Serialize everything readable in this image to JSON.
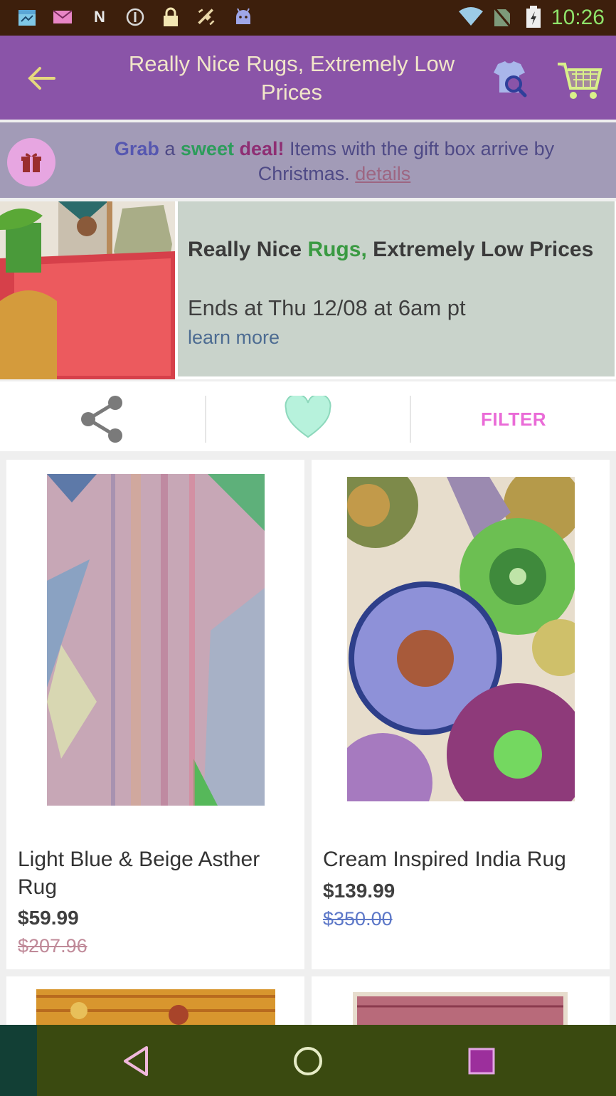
{
  "statusbar": {
    "time": "10:26",
    "icons": [
      "calendar-icon",
      "mail-icon",
      "notification-n-icon",
      "info-circle-icon",
      "lock-icon",
      "satellite-icon",
      "android-icon",
      "wifi-icon",
      "no-sim-icon",
      "battery-charging-icon"
    ]
  },
  "appbar": {
    "title": "Really Nice Rugs, Extremely Low Prices",
    "icons": [
      "back-arrow-icon",
      "search-shirt-icon",
      "cart-icon"
    ]
  },
  "promo": {
    "t1": "Grab",
    "t2": " a ",
    "t3": "sweet",
    "t4": " ",
    "t5": "deal!",
    "t6": " Items with the gift box arrive by Christmas.",
    "details": "details",
    "icon": "gift-icon"
  },
  "hero": {
    "title_a": "Really Nice ",
    "title_b": "Rugs,",
    "title_c": " Extremely Low Prices",
    "ends": "Ends at Thu 12/08 at 6am pt",
    "learn_more": "learn more"
  },
  "actions": {
    "filter": "FILTER",
    "icons": [
      "share-icon",
      "heart-icon"
    ]
  },
  "products": [
    {
      "name": "Light Blue & Beige Asther Rug",
      "price": "$59.99",
      "original_price": "$207.96"
    },
    {
      "name": "Cream Inspired India Rug",
      "price": "$139.99",
      "original_price": "$350.00"
    }
  ],
  "navbar": {
    "icons": [
      "back-triangle-icon",
      "home-circle-icon",
      "recents-square-icon"
    ]
  },
  "colors": {
    "statusbar": "#3d1f0c",
    "appbar": "#8a54a8",
    "promo": "#a29bb7",
    "hero_info": "#c9d3cb",
    "navbar": "#3a4a10",
    "time": "#8fe36a"
  }
}
